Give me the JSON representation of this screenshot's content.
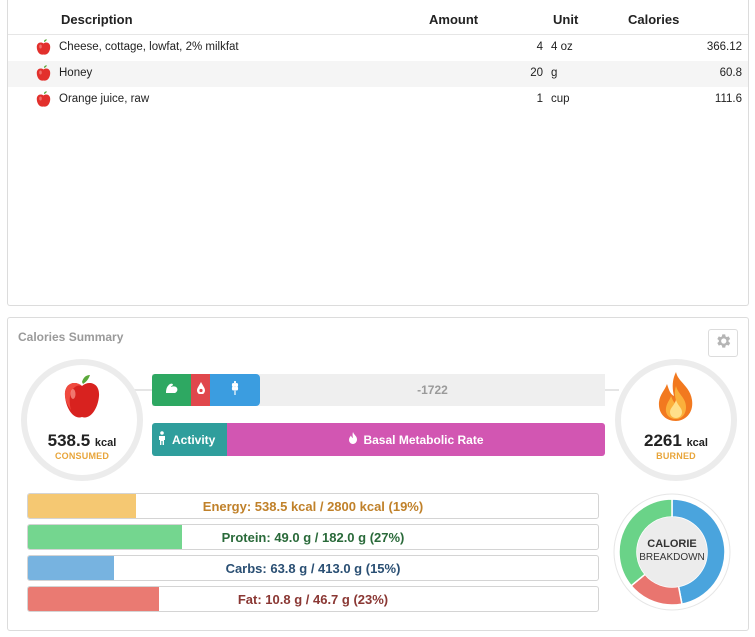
{
  "diary": {
    "headers": {
      "description": "Description",
      "amount": "Amount",
      "unit": "Unit",
      "calories": "Calories"
    },
    "rows": [
      {
        "description": "Cheese, cottage, lowfat, 2% milkfat",
        "amount": "4",
        "unit": "4 oz",
        "calories": "366.12",
        "icon": "apple-icon"
      },
      {
        "description": "Honey",
        "amount": "20",
        "unit": "g",
        "calories": "60.8",
        "icon": "apple-icon"
      },
      {
        "description": "Orange juice, raw",
        "amount": "1",
        "unit": "cup",
        "calories": "111.6",
        "icon": "apple-icon"
      }
    ]
  },
  "summary": {
    "title": "Calories Summary",
    "consumed": {
      "value": "538.5",
      "unit": "kcal",
      "label": "CONSUMED",
      "icon": "apple-icon"
    },
    "burned": {
      "value": "2261",
      "unit": "kcal",
      "label": "BURNED",
      "icon": "flame-icon"
    },
    "net_value": "-1722",
    "macro_icons": [
      "protein-arm-icon",
      "fat-drop-icon",
      "carbs-wheat-icon"
    ],
    "activity_label": "Activity",
    "bmr_label": "Basal Metabolic Rate",
    "targets": [
      {
        "key": "energy",
        "text": "Energy: 538.5 kcal / 2800 kcal (19%)",
        "percent": 19,
        "fill": "#f5c872",
        "color": "#c0812a"
      },
      {
        "key": "protein",
        "text": "Protein: 49.0 g / 182.0 g (27%)",
        "percent": 27,
        "fill": "#74d68f",
        "color": "#2a6a3a"
      },
      {
        "key": "carbs",
        "text": "Carbs: 63.8 g / 413.0 g (15%)",
        "percent": 15,
        "fill": "#77b3e0",
        "color": "#2a4f73"
      },
      {
        "key": "fat",
        "text": "Fat: 10.8 g / 46.7 g (23%)",
        "percent": 23,
        "fill": "#ea7a72",
        "color": "#8a3733"
      }
    ],
    "breakdown": {
      "title": "CALORIE",
      "subtitle": "BREAKDOWN",
      "slices": [
        {
          "name": "carbs",
          "fraction": 0.47,
          "color": "#4aa4dd"
        },
        {
          "name": "fat",
          "fraction": 0.17,
          "color": "#e9756f"
        },
        {
          "name": "protein",
          "fraction": 0.36,
          "color": "#6ad388"
        }
      ]
    }
  }
}
